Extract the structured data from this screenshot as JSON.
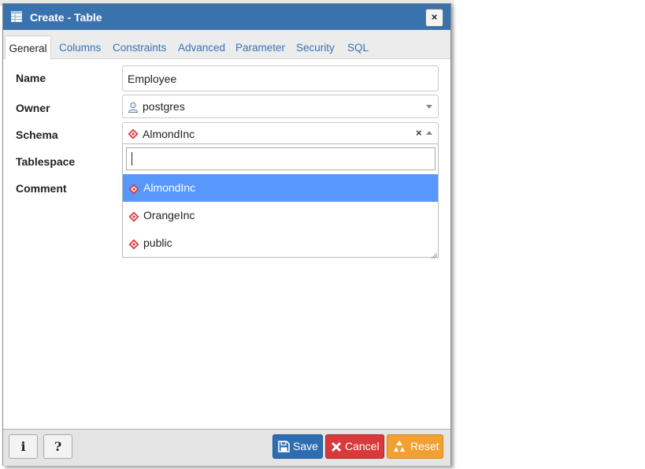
{
  "dialog": {
    "title": "Create - Table",
    "title_icon": "table-icon",
    "close_glyph": "×"
  },
  "tabs": [
    {
      "label": "General",
      "active": true
    },
    {
      "label": "Columns"
    },
    {
      "label": "Constraints"
    },
    {
      "label": "Advanced"
    },
    {
      "label": "Parameter"
    },
    {
      "label": "Security"
    },
    {
      "label": "SQL"
    }
  ],
  "form": {
    "name_label": "Name",
    "name_value": "Employee",
    "owner_label": "Owner",
    "owner_value": "postgres",
    "owner_icon": "user-icon",
    "schema_label": "Schema",
    "schema_value": "AlmondInc",
    "schema_icon": "schema-icon",
    "schema_clear_glyph": "×",
    "tablespace_label": "Tablespace",
    "comment_label": "Comment"
  },
  "schema_dropdown": {
    "search_value": "",
    "options": [
      {
        "label": "AlmondInc",
        "selected": true
      },
      {
        "label": "OrangeInc"
      },
      {
        "label": "public"
      }
    ]
  },
  "footer": {
    "info_glyph": "i",
    "help_glyph": "?",
    "save_label": "Save",
    "cancel_label": "Cancel",
    "reset_label": "Reset"
  },
  "colors": {
    "titlebar": "#3a72ae",
    "save": "#2f6db2",
    "cancel": "#d9393b",
    "reset": "#f1a032",
    "selected_option": "#5897fb",
    "schema_icon": "#d9393b"
  }
}
